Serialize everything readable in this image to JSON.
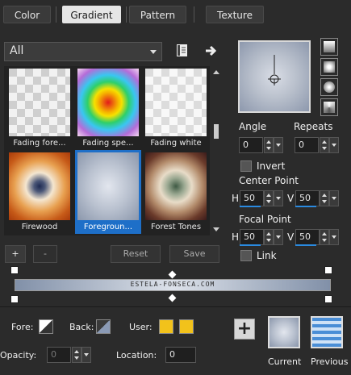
{
  "tabs": [
    {
      "label": "Color",
      "active": false
    },
    {
      "label": "Gradient",
      "active": true
    },
    {
      "label": "Pattern",
      "active": false
    },
    {
      "label": "Texture",
      "active": false
    }
  ],
  "category": {
    "value": "All"
  },
  "gallery": {
    "items": [
      {
        "label": "Fading fore...",
        "selected": false
      },
      {
        "label": "Fading spe...",
        "selected": false
      },
      {
        "label": "Fading white",
        "selected": false
      },
      {
        "label": "Firewood",
        "selected": false
      },
      {
        "label": "Foregroun...",
        "selected": true
      },
      {
        "label": "Forest Tones",
        "selected": false
      }
    ]
  },
  "buttons": {
    "add": "+",
    "remove": "-",
    "reset": "Reset",
    "save": "Save"
  },
  "angle": {
    "label": "Angle",
    "value": "0"
  },
  "repeats": {
    "label": "Repeats",
    "value": "0"
  },
  "invert": {
    "label": "Invert",
    "checked": false
  },
  "center_point": {
    "label": "Center Point",
    "h_label": "H",
    "h_value": "50",
    "v_label": "V",
    "v_value": "50"
  },
  "focal_point": {
    "label": "Focal Point",
    "h_label": "H",
    "h_value": "50",
    "v_label": "V",
    "v_value": "50"
  },
  "link": {
    "label": "Link",
    "checked": false
  },
  "gradient_bar": {
    "text": "ESTELA-FONSECA.COM"
  },
  "fore": {
    "label": "Fore:"
  },
  "back": {
    "label": "Back:"
  },
  "user": {
    "label": "User:",
    "color1": "#f2c21b",
    "color2": "#f2c21b"
  },
  "opacity": {
    "label": "Opacity:",
    "value": "0"
  },
  "location": {
    "label": "Location:",
    "value": "0"
  },
  "current": {
    "label": "Current"
  },
  "previous": {
    "label": "Previous"
  },
  "colors": {
    "accent": "#1e6fc8",
    "bg": "#2b2b2b",
    "line": "#2a8ae0"
  }
}
